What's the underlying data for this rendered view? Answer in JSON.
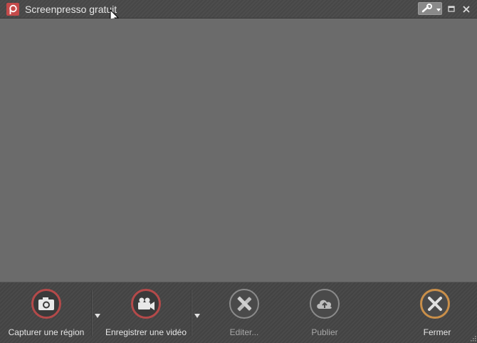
{
  "window": {
    "title": "Screenpresso gratuit",
    "buttons": {
      "tools": "wrench-icon",
      "maximize": "maximize-icon",
      "close": "close-icon"
    }
  },
  "toolbar": {
    "capture_region": "Capturer une région",
    "record_video": "Enregistrer une vidéo",
    "edit": "Editer...",
    "publish": "Publier",
    "close": "Fermer"
  },
  "colors": {
    "accent_red": "#b44a4a",
    "accent_orange": "#c98f4a",
    "background": "#6b6b6b"
  }
}
